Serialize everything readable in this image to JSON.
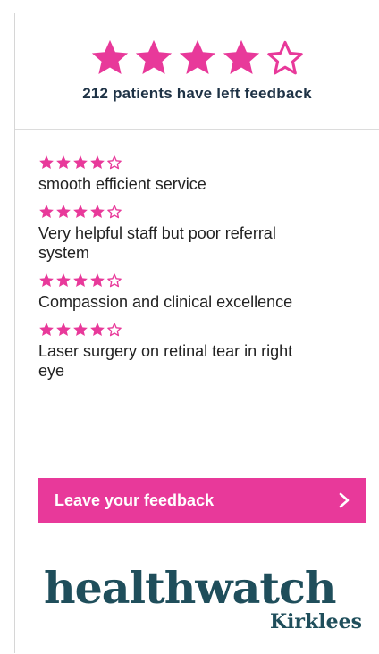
{
  "summary": {
    "rating": 4,
    "max_rating": 5,
    "text": "212 patients have left feedback"
  },
  "reviews": [
    {
      "rating": 4,
      "text": "smooth efficient service"
    },
    {
      "rating": 4,
      "text": "Very helpful staff but poor referral system"
    },
    {
      "rating": 4,
      "text": "Compassion and clinical excellence"
    },
    {
      "rating": 4,
      "text": "Laser surgery on retinal tear in right eye"
    }
  ],
  "button": {
    "label": "Leave your feedback",
    "icon": "chevron-right-icon"
  },
  "logo": {
    "wordmark": "healthwatch",
    "subtitle": "Kirklees"
  },
  "colors": {
    "accent": "#e8399a",
    "heading": "#1e3245",
    "brand": "#1f4e5b"
  }
}
